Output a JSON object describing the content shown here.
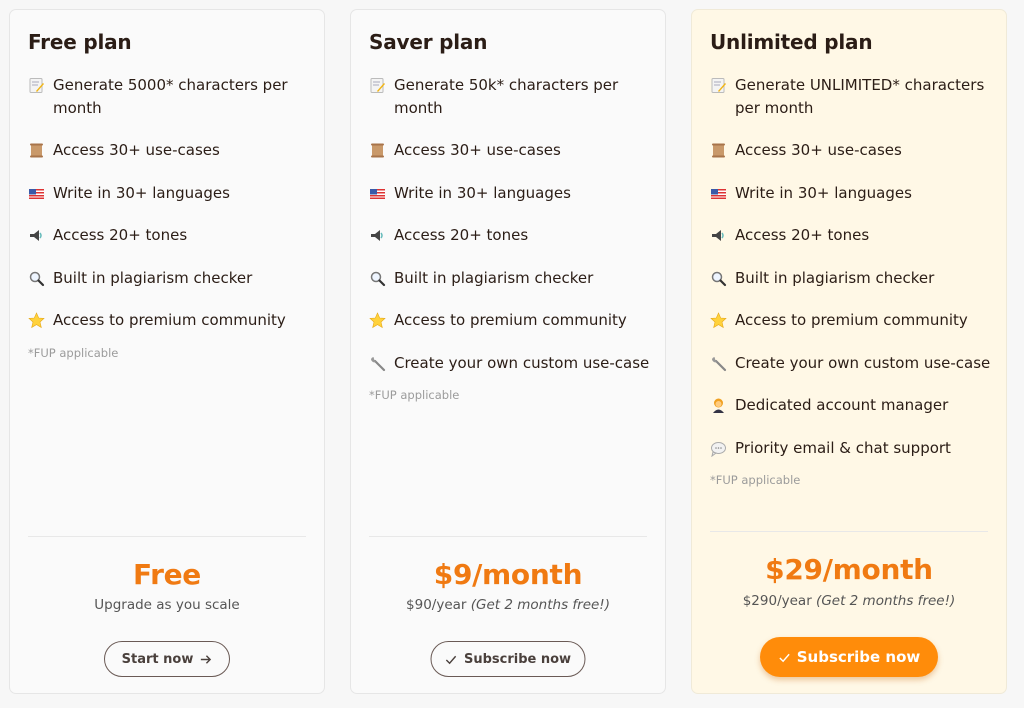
{
  "plans": [
    {
      "title": "Free plan",
      "features": [
        {
          "icon": "memo-icon",
          "text": "Generate 5000* characters per month"
        },
        {
          "icon": "scroll-icon",
          "text": "Access 30+ use-cases"
        },
        {
          "icon": "us-flag-icon",
          "text": "Write in 30+ languages"
        },
        {
          "icon": "speaker-icon",
          "text": "Access 20+ tones"
        },
        {
          "icon": "magnifier-icon",
          "text": "Built in plagiarism checker"
        },
        {
          "icon": "star-icon",
          "text": "Access to premium community"
        }
      ],
      "footnote": "*FUP applicable",
      "price": "Free",
      "price_note": "Upgrade as you scale",
      "price_note_italic": "",
      "button": {
        "label": "Start now",
        "icon": "arrow-right-icon"
      }
    },
    {
      "title": "Saver plan",
      "features": [
        {
          "icon": "memo-icon",
          "text": "Generate 50k* characters per month"
        },
        {
          "icon": "scroll-icon",
          "text": "Access 30+ use-cases"
        },
        {
          "icon": "us-flag-icon",
          "text": "Write in 30+ languages"
        },
        {
          "icon": "speaker-icon",
          "text": "Access 20+ tones"
        },
        {
          "icon": "magnifier-icon",
          "text": "Built in plagiarism checker"
        },
        {
          "icon": "star-icon",
          "text": "Access to premium community"
        },
        {
          "icon": "wrench-icon",
          "text": "Create your own custom use-case"
        }
      ],
      "footnote": "*FUP applicable",
      "price": "$9/month",
      "price_note": "$90/year",
      "price_note_italic": "(Get 2 months free!)",
      "button": {
        "label": "Subscribe now",
        "icon": "check-icon"
      }
    },
    {
      "title": "Unlimited plan",
      "features": [
        {
          "icon": "memo-icon",
          "text": "Generate UNLIMITED* characters per month"
        },
        {
          "icon": "scroll-icon",
          "text": "Access 30+ use-cases"
        },
        {
          "icon": "us-flag-icon",
          "text": "Write in 30+ languages"
        },
        {
          "icon": "speaker-icon",
          "text": "Access 20+ tones"
        },
        {
          "icon": "magnifier-icon",
          "text": "Built in plagiarism checker"
        },
        {
          "icon": "star-icon",
          "text": "Access to premium community"
        },
        {
          "icon": "wrench-icon",
          "text": "Create your own custom use-case"
        },
        {
          "icon": "account-manager-icon",
          "text": "Dedicated account manager"
        },
        {
          "icon": "speech-bubble-icon",
          "text": "Priority email & chat support"
        }
      ],
      "footnote": "*FUP applicable",
      "price": "$29/month",
      "price_note": "$290/year",
      "price_note_italic": "(Get 2 months free!)",
      "button": {
        "label": "Subscribe now",
        "icon": "check-icon"
      }
    }
  ],
  "colors": {
    "accent": "#f07a12",
    "button_primary": "#ff8c0a",
    "highlight_card": "#fff8e6"
  }
}
